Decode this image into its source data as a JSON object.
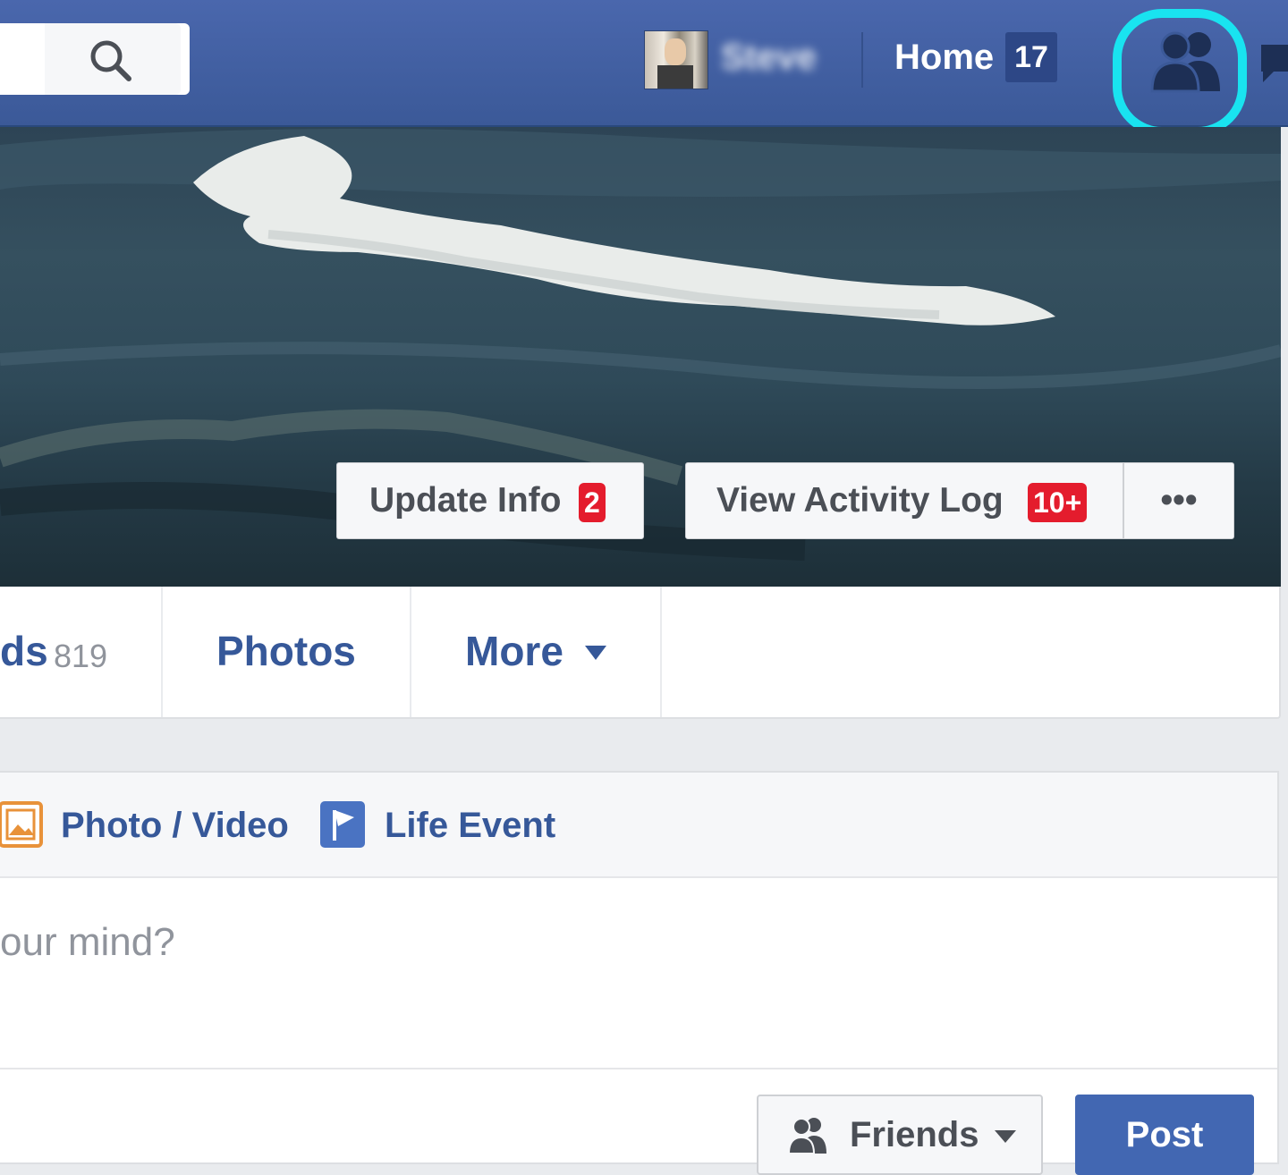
{
  "colors": {
    "nav": "#3b5998",
    "link": "#365899",
    "badge": "#e41c2d",
    "highlight": "#19e3f0",
    "post": "#4267b2"
  },
  "topbar": {
    "search_icon": "search-icon",
    "user_name": "Steve",
    "home_label": "Home",
    "home_count": "17",
    "friend_requests_icon": "friends-icon",
    "messages_icon": "messages-icon"
  },
  "cover": {
    "update_info_label": "Update Info",
    "update_info_badge": "2",
    "activity_log_label": "View Activity Log",
    "activity_log_badge": "10+",
    "more_label": "•••"
  },
  "tabs": {
    "friends_label": "ds",
    "friends_count": "819",
    "photos_label": "Photos",
    "more_label": "More"
  },
  "composer": {
    "photo_video_label": "Photo / Video",
    "life_event_label": "Life Event",
    "placeholder": "our mind?",
    "audience_label": "Friends",
    "post_label": "Post"
  }
}
